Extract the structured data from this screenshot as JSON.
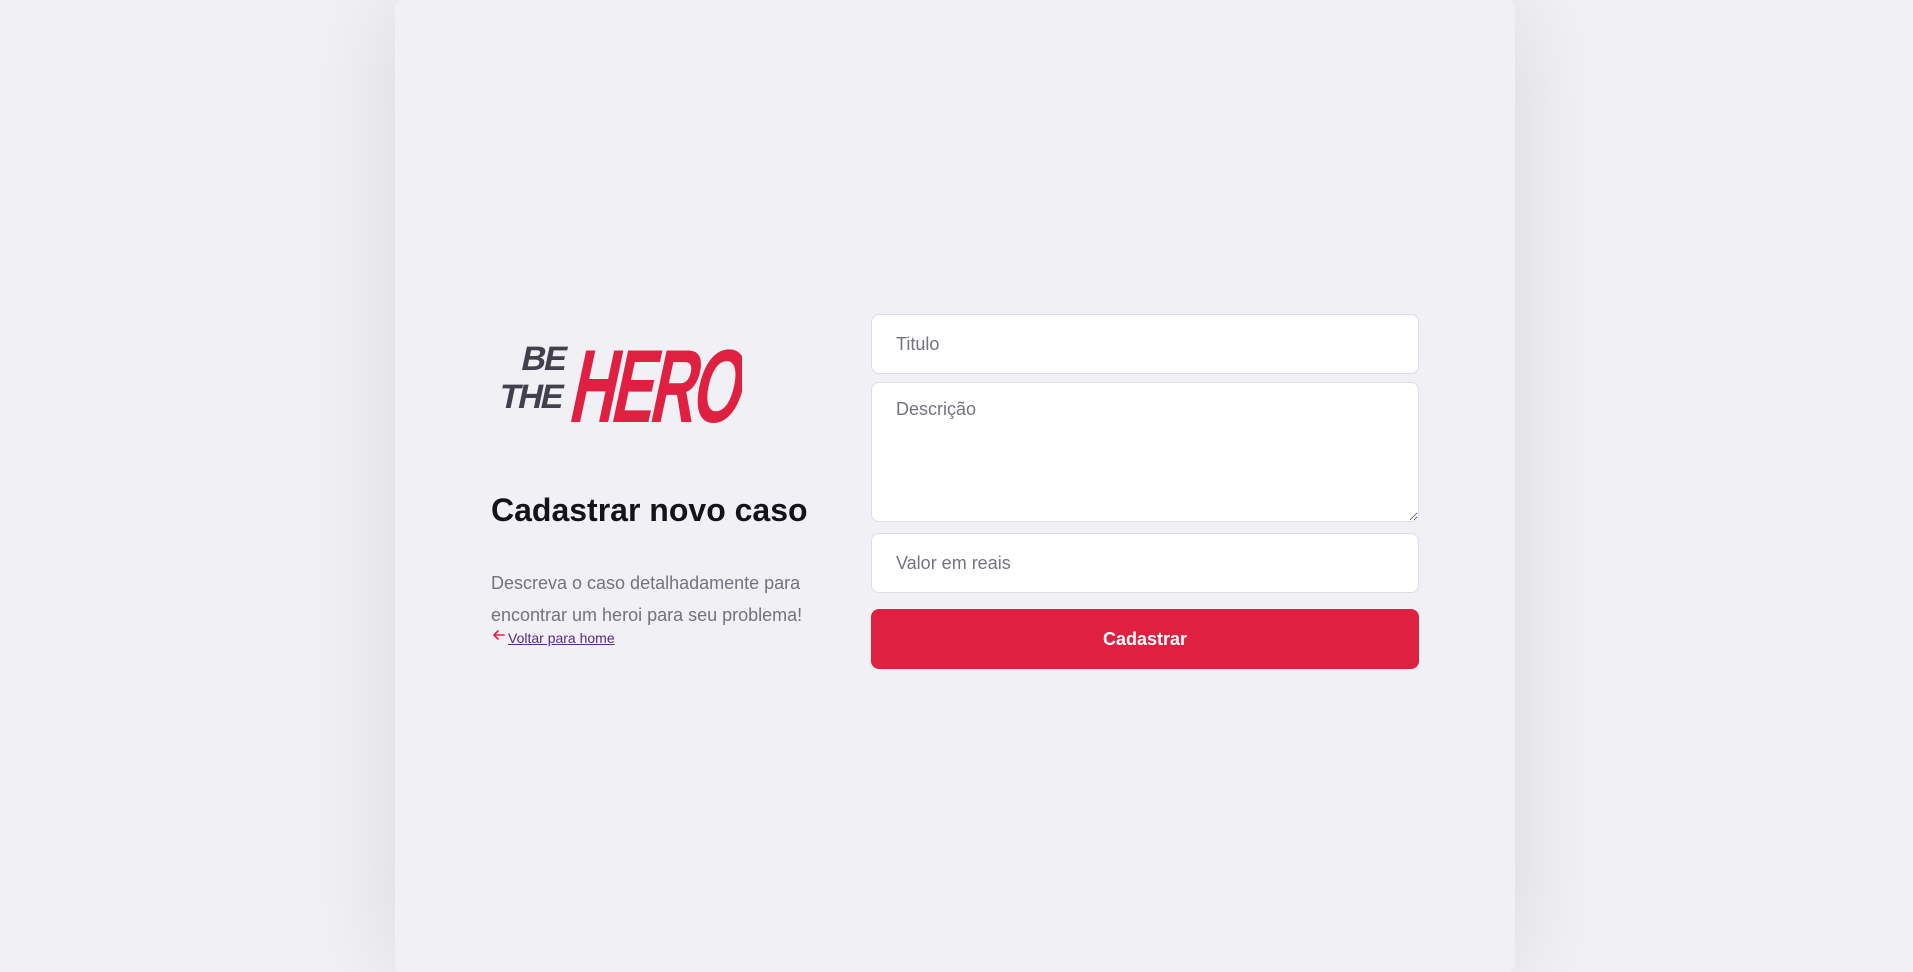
{
  "brand": {
    "logo_small_top": "BE",
    "logo_small_bottom": "THE",
    "logo_large": "HERO",
    "dark_color": "#41414d",
    "accent_color": "#e02041"
  },
  "content": {
    "title": "Cadastrar novo caso",
    "description": "Descreva o caso detalhadamente para encontrar um heroi para seu problema!",
    "back_link_label": "Voltar para home",
    "back_icon": "arrow-left-icon"
  },
  "form": {
    "title_placeholder": "Titulo",
    "title_value": "",
    "description_placeholder": "Descrição",
    "description_value": "",
    "value_placeholder": "Valor em reais",
    "value_value": "",
    "submit_label": "Cadastrar"
  }
}
